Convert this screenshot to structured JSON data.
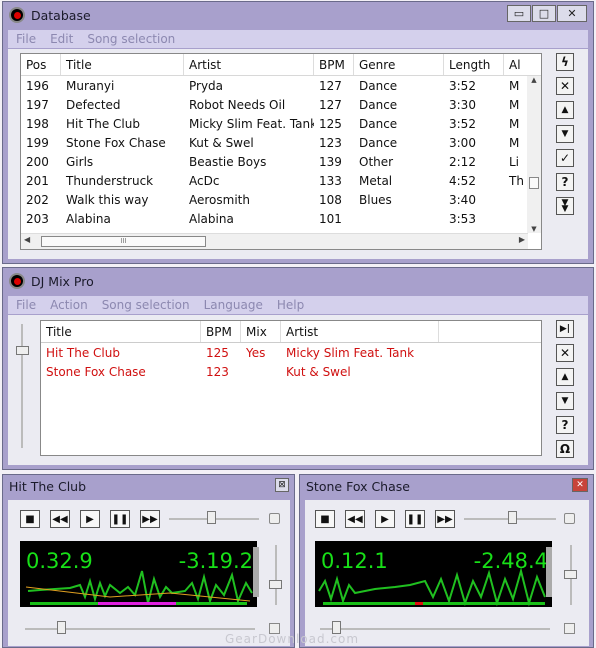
{
  "database": {
    "title": "Database",
    "menu": [
      "File",
      "Edit",
      "Song selection"
    ],
    "columns": [
      "Pos",
      "Title",
      "Artist",
      "BPM",
      "Genre",
      "Length",
      "Al"
    ],
    "rows": [
      [
        "196",
        "Muranyi",
        "Pryda",
        "127",
        "Dance",
        "3:52",
        "M"
      ],
      [
        "197",
        "Defected",
        "Robot Needs Oil",
        "127",
        "Dance",
        "3:30",
        "M"
      ],
      [
        "198",
        "Hit The Club",
        "Micky Slim Feat. Tank",
        "125",
        "Dance",
        "3:52",
        "M"
      ],
      [
        "199",
        "Stone Fox Chase",
        "Kut & Swel",
        "123",
        "Dance",
        "3:00",
        "M"
      ],
      [
        "200",
        "Girls",
        "Beastie Boys",
        "139",
        "Other",
        "2:12",
        "Li"
      ],
      [
        "201",
        "Thunderstruck",
        "AcDc",
        "133",
        "Metal",
        "4:52",
        "Th"
      ],
      [
        "202",
        "Walk this way",
        "Aerosmith",
        "108",
        "Blues",
        "3:40",
        ""
      ],
      [
        "203",
        "Alabina",
        "Alabina",
        "101",
        "",
        "3:53",
        ""
      ]
    ],
    "scroll_grip": "III"
  },
  "djmix": {
    "title": "DJ Mix Pro",
    "menu": [
      "File",
      "Action",
      "Song selection",
      "Language",
      "Help"
    ],
    "columns": [
      "Title",
      "BPM",
      "Mix",
      "Artist"
    ],
    "rows": [
      [
        "Hit The Club",
        "125",
        "Yes",
        "Micky Slim Feat. Tank"
      ],
      [
        "Stone Fox Chase",
        "123",
        "",
        "Kut & Swel"
      ]
    ],
    "row_color": "#d01010"
  },
  "deck1": {
    "title": "Hit The Club",
    "elapsed": "0.32.9",
    "remaining": "-3.19.2",
    "close_glyph": "⊠"
  },
  "deck2": {
    "title": "Stone Fox Chase",
    "elapsed": "0.12.1",
    "remaining": "-2.48.4",
    "close_glyph": "✕"
  },
  "watermark": "GearDownload.com",
  "icons": {
    "minimize": "▭",
    "maximize": "□",
    "close": "✕",
    "stop": "■",
    "rewind": "◀◀",
    "play": "▶",
    "pause": "❚❚",
    "forward": "▶▶"
  }
}
